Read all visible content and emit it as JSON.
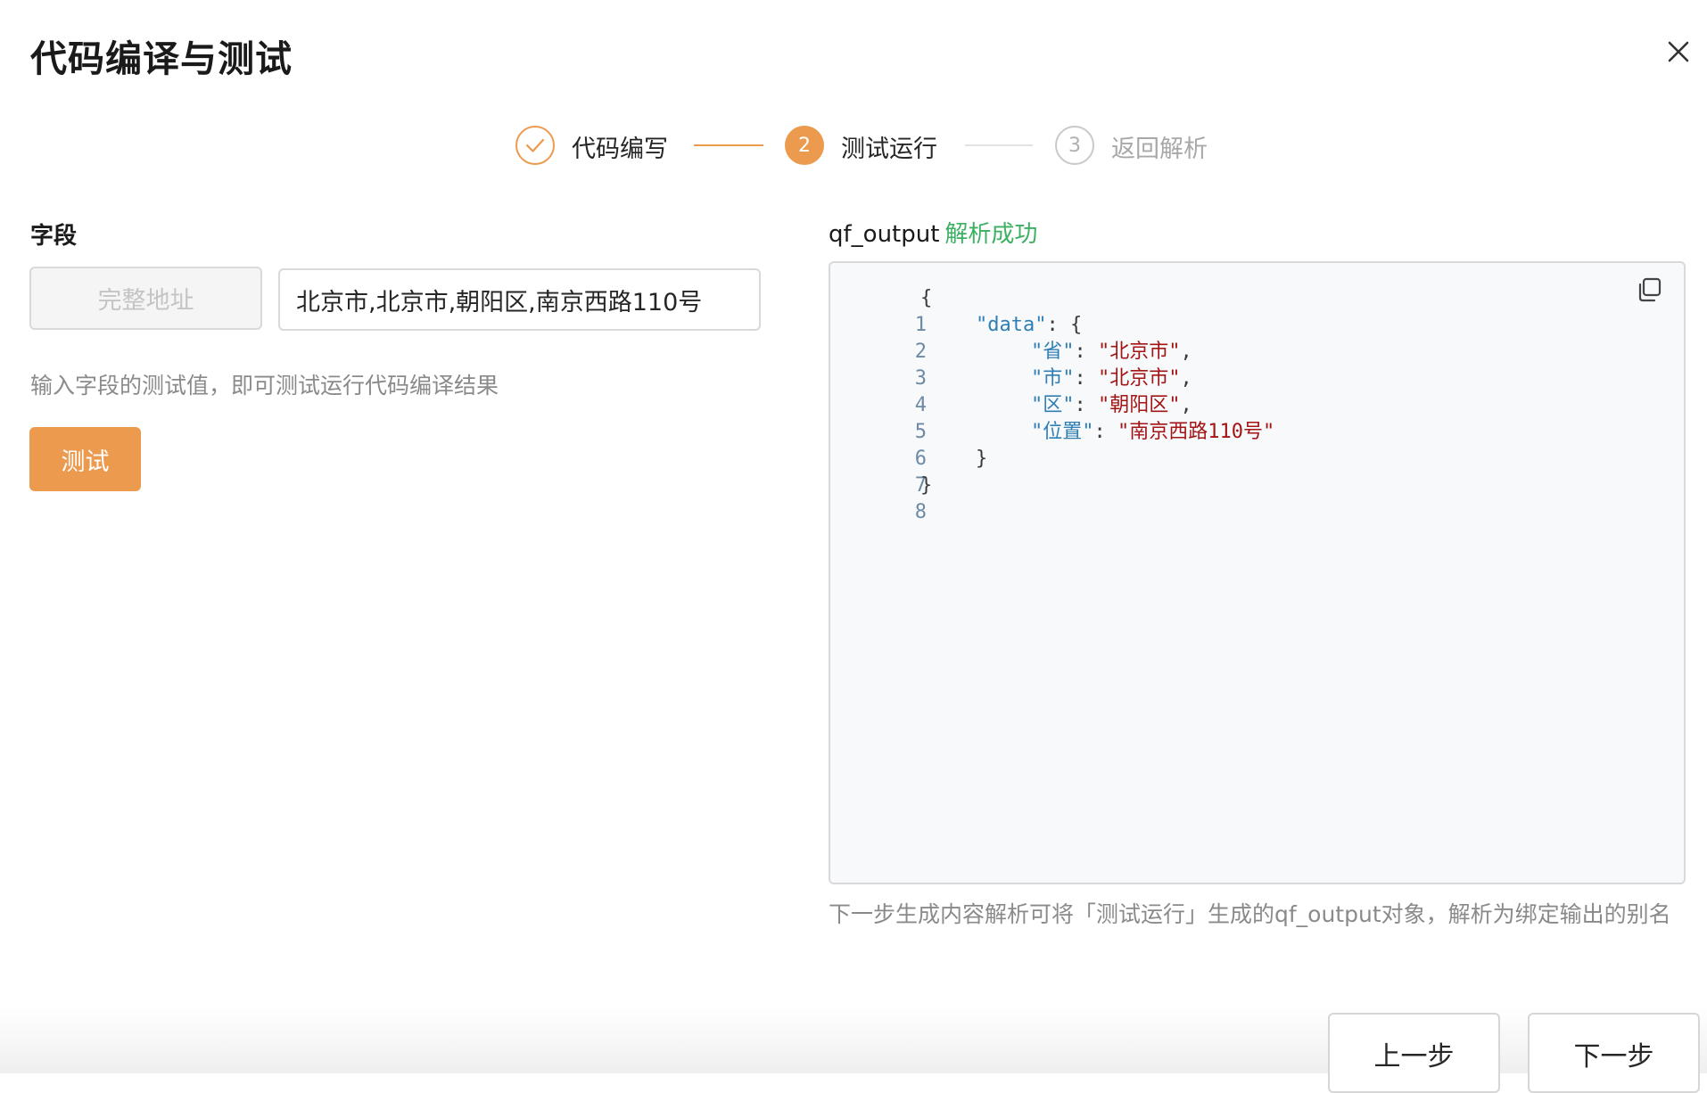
{
  "dialog": {
    "title": "代码编译与测试"
  },
  "steps": [
    {
      "number": "",
      "label": "代码编写",
      "status": "done"
    },
    {
      "number": "2",
      "label": "测试运行",
      "status": "active"
    },
    {
      "number": "3",
      "label": "返回解析",
      "status": "pending"
    }
  ],
  "left": {
    "field_label": "字段",
    "field_name": "完整地址",
    "field_value": "北京市,北京市,朝阳区,南京西路110号",
    "hint": "输入字段的测试值，即可测试运行代码编译结果",
    "test_button": "测试"
  },
  "right": {
    "output_name": "qf_output",
    "output_status": "解析成功",
    "code": {
      "line_numbers": [
        "1",
        "2",
        "3",
        "4",
        "5",
        "6",
        "7",
        "8"
      ],
      "open_brace": "{",
      "data_key": "\"data\"",
      "colon": ":",
      "comma": ",",
      "close_brace": "}",
      "entries": [
        {
          "key": "\"省\"",
          "value": "\"北京市\""
        },
        {
          "key": "\"市\"",
          "value": "\"北京市\""
        },
        {
          "key": "\"区\"",
          "value": "\"朝阳区\""
        },
        {
          "key": "\"位置\"",
          "value": "\"南京西路110号\""
        }
      ]
    },
    "footer_hint": "下一步生成内容解析可将「测试运行」生成的qf_output对象，解析为绑定输出的别名"
  },
  "buttons": {
    "prev": "上一步",
    "next": "下一步"
  },
  "icons": {
    "close": "close-icon",
    "check": "check-icon",
    "copy": "copy-icon"
  },
  "colors": {
    "accent": "#eb9a4e",
    "success": "#3cb062",
    "json_key": "#2f7fb5",
    "json_string": "#a31515"
  }
}
